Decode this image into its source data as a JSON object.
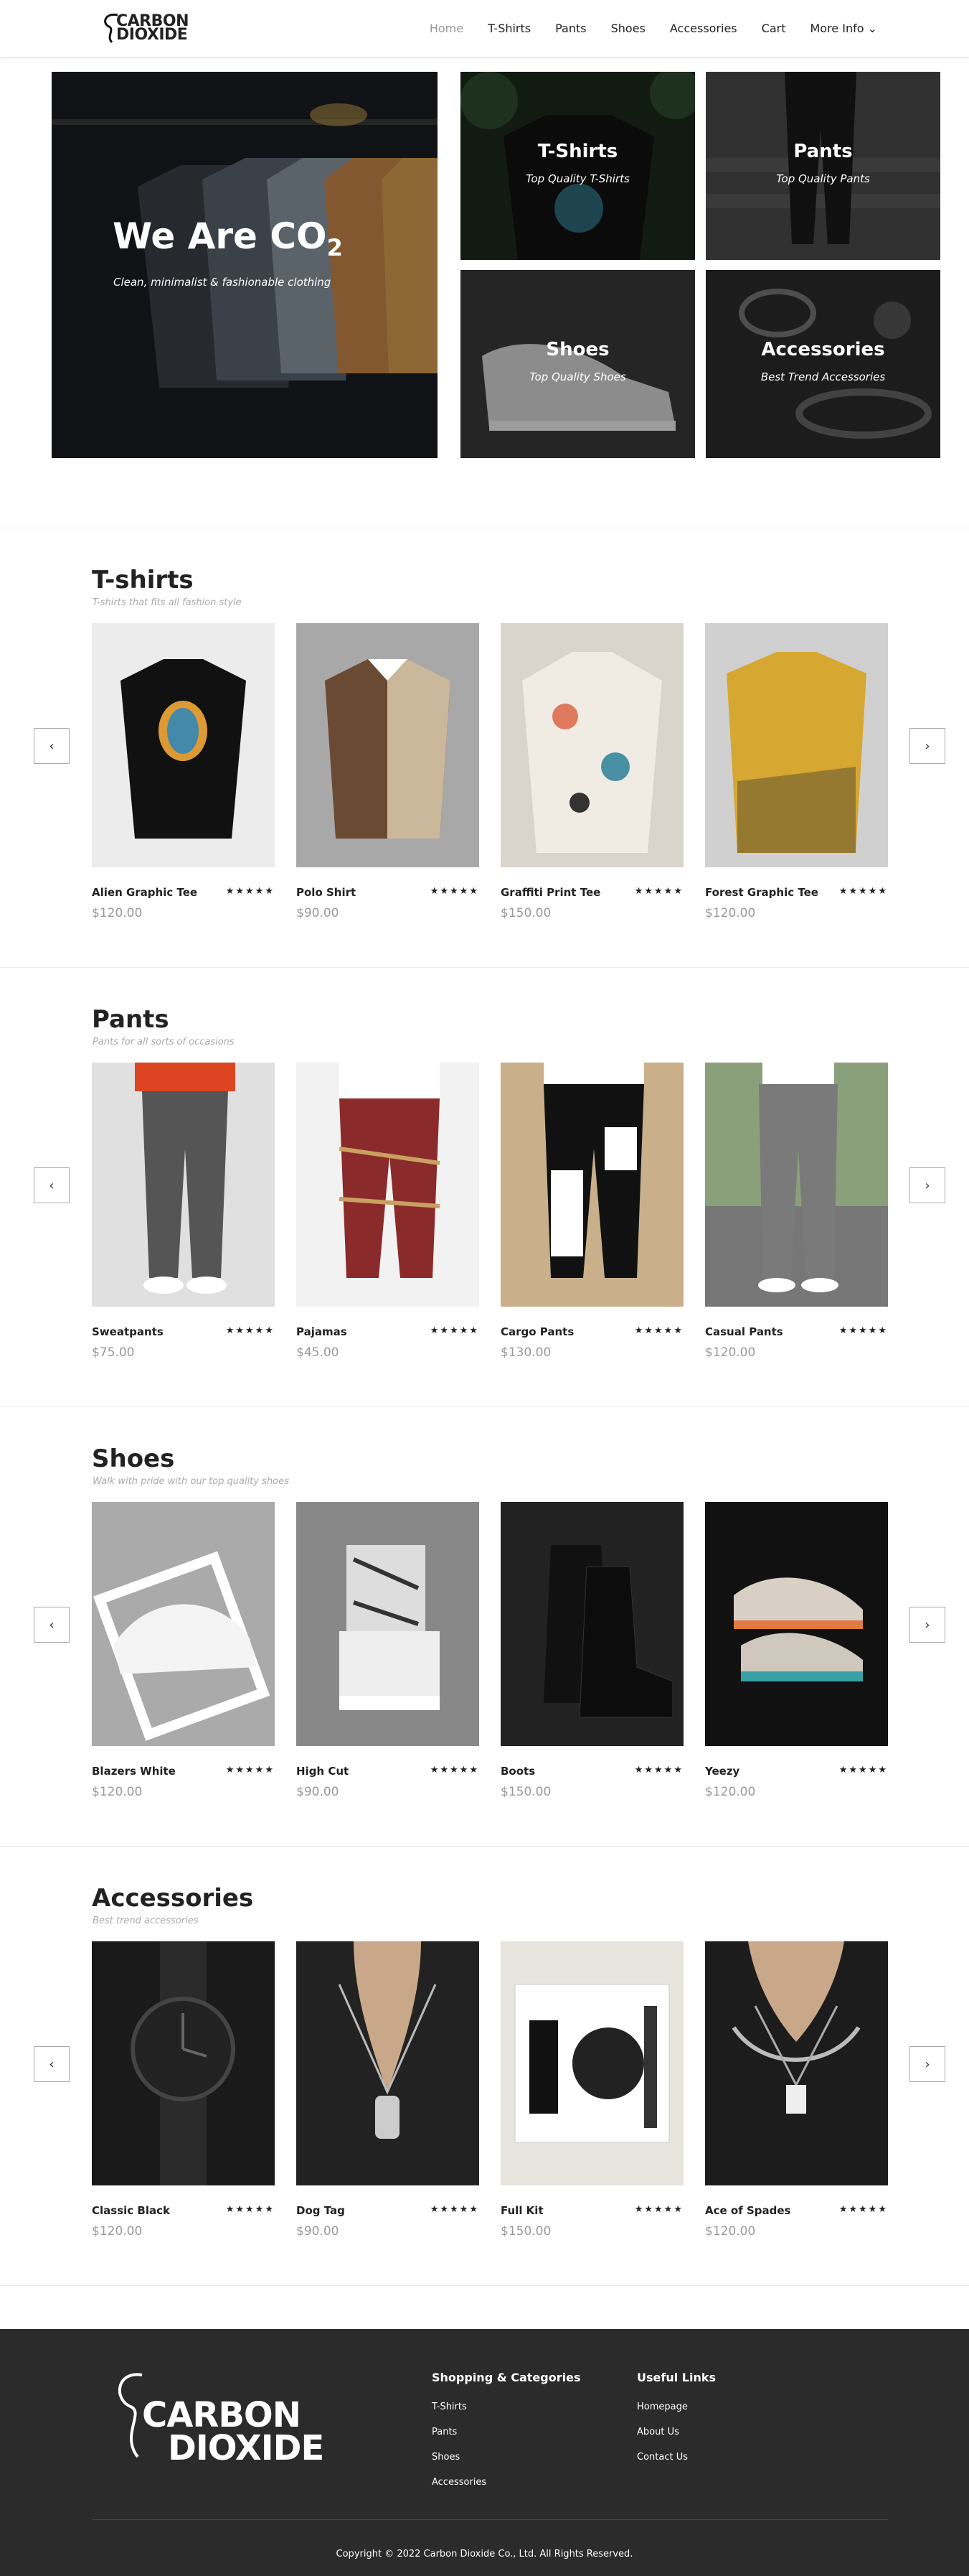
{
  "header": {
    "logo_top": "CARBON",
    "logo_bottom": "DIOXIDE",
    "nav": [
      "Home",
      "T-Shirts",
      "Pants",
      "Shoes",
      "Accessories",
      "Cart",
      "More Info ⌄"
    ]
  },
  "hero": {
    "title": "We Are CO",
    "title_sub": "2",
    "subtitle": "Clean, minimalist & fashionable clothing",
    "tiles": [
      {
        "title": "T-Shirts",
        "subtitle": "Top Quality T-Shirts"
      },
      {
        "title": "Pants",
        "subtitle": "Top Quality Pants"
      },
      {
        "title": "Shoes",
        "subtitle": "Top Quality Shoes"
      },
      {
        "title": "Accessories",
        "subtitle": "Best Trend Accessories"
      }
    ]
  },
  "sections": [
    {
      "title": "T-shirts",
      "subtitle": "T-shirts that fits all fashion style",
      "items": [
        {
          "name": "Alien Graphic Tee",
          "price": "$120.00",
          "rating": 5
        },
        {
          "name": "Polo Shirt",
          "price": "$90.00",
          "rating": 5
        },
        {
          "name": "Graffiti Print Tee",
          "price": "$150.00",
          "rating": 5
        },
        {
          "name": "Forest Graphic Tee",
          "price": "$120.00",
          "rating": 5
        }
      ]
    },
    {
      "title": "Pants",
      "subtitle": "Pants for all sorts of occasions",
      "items": [
        {
          "name": "Sweatpants",
          "price": "$75.00",
          "rating": 5
        },
        {
          "name": "Pajamas",
          "price": "$45.00",
          "rating": 5
        },
        {
          "name": "Cargo Pants",
          "price": "$130.00",
          "rating": 5
        },
        {
          "name": "Casual Pants",
          "price": "$120.00",
          "rating": 5
        }
      ]
    },
    {
      "title": "Shoes",
      "subtitle": "Walk with pride with our top quality shoes",
      "items": [
        {
          "name": "Blazers White",
          "price": "$120.00",
          "rating": 5
        },
        {
          "name": "High Cut",
          "price": "$90.00",
          "rating": 5
        },
        {
          "name": "Boots",
          "price": "$150.00",
          "rating": 5
        },
        {
          "name": "Yeezy",
          "price": "$120.00",
          "rating": 5
        }
      ]
    },
    {
      "title": "Accessories",
      "subtitle": "Best trend accessories",
      "items": [
        {
          "name": "Classic Black",
          "price": "$120.00",
          "rating": 5
        },
        {
          "name": "Dog Tag",
          "price": "$90.00",
          "rating": 5
        },
        {
          "name": "Full Kit",
          "price": "$150.00",
          "rating": 5
        },
        {
          "name": "Ace of Spades",
          "price": "$120.00",
          "rating": 5
        }
      ]
    }
  ],
  "stars": "★★★★★",
  "arrows": {
    "prev": "‹",
    "next": "›"
  },
  "footer": {
    "logo_top": "CARBON",
    "logo_bottom": "DIOXIDE",
    "col1_title": "Shopping & Categories",
    "col1": [
      "T-Shirts",
      "Pants",
      "Shoes",
      "Accessories"
    ],
    "col2_title": "Useful Links",
    "col2": [
      "Homepage",
      "About Us",
      "Contact Us"
    ],
    "copyright": "Copyright © 2022 Carbon Dioxide Co., Ltd. All Rights Reserved."
  },
  "colors": {
    "footer_bg": "#2b2b2b",
    "text": "#222222",
    "price": "#999999"
  }
}
